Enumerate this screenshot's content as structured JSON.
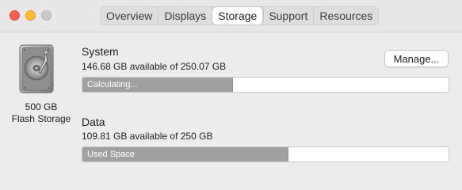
{
  "window": {
    "tabs": [
      {
        "label": "Overview"
      },
      {
        "label": "Displays"
      },
      {
        "label": "Storage"
      },
      {
        "label": "Support"
      },
      {
        "label": "Resources"
      }
    ],
    "active_tab": "Storage"
  },
  "disk": {
    "icon": "drive-icon",
    "size_line1": "500 GB",
    "size_line2": "Flash Storage"
  },
  "volumes": [
    {
      "name": "System",
      "available": "146.68 GB available of 250.07 GB",
      "bar_label": "Calculating...",
      "used_fraction": 0.41,
      "fill_color": "#a0a0a0"
    },
    {
      "name": "Data",
      "available": "109.81 GB available of 250 GB",
      "bar_label": "Used Space",
      "used_fraction": 0.56,
      "fill_color": "#a0a0a0"
    }
  ],
  "manage_button": {
    "label": "Manage..."
  },
  "colors": {
    "close": "#fe5f57",
    "minimize": "#febc2e",
    "zoom_disabled": "#c9c9c9"
  }
}
